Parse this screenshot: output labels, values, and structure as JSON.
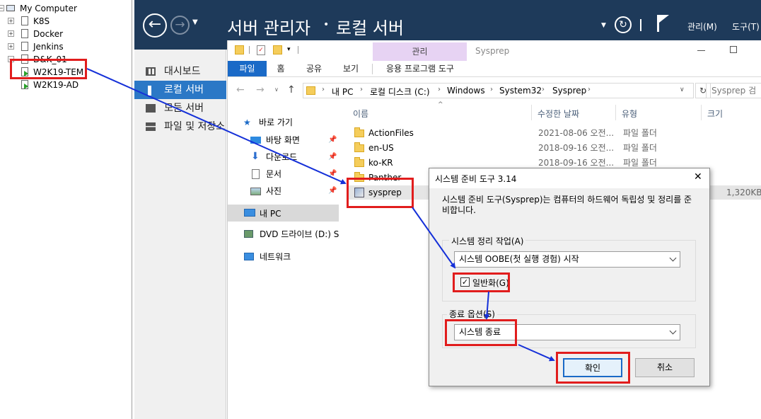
{
  "tree": {
    "root": "My Computer",
    "items": [
      "K8S",
      "Docker",
      "Jenkins",
      "D&K_01",
      "W2K19-TEM",
      "W2K19-AD"
    ]
  },
  "server_manager": {
    "title": "서버 관리자",
    "breadcrumb_sep": "•",
    "page": "로컬 서버",
    "menu_manage": "관리(M)",
    "menu_tools": "도구(T)",
    "nav": [
      "대시보드",
      "로컬 서버",
      "모든 서버",
      "파일 및 저장소"
    ]
  },
  "explorer": {
    "context_tab": "관리",
    "window_title": "Sysprep",
    "tabs": [
      "파일",
      "홈",
      "공유",
      "보기",
      "응용 프로그램 도구"
    ],
    "path": [
      "내 PC",
      "로컬 디스크 (C:)",
      "Windows",
      "System32",
      "Sysprep"
    ],
    "search_placeholder": "Sysprep 검",
    "quick_access": "바로 가기",
    "nav_items": [
      "바탕 화면",
      "다운로드",
      "문서",
      "사진",
      "내 PC",
      "DVD 드라이브 (D:) S",
      "네트워크"
    ],
    "columns": [
      "이름",
      "수정한 날짜",
      "유형",
      "크기"
    ],
    "files": [
      {
        "name": "ActionFiles",
        "date": "2021-08-06 오전...",
        "type": "파일 폴더",
        "size": ""
      },
      {
        "name": "en-US",
        "date": "2018-09-16 오전...",
        "type": "파일 폴더",
        "size": ""
      },
      {
        "name": "ko-KR",
        "date": "2018-09-16 오전...",
        "type": "파일 폴더",
        "size": ""
      },
      {
        "name": "Panther",
        "date": "",
        "type": "",
        "size": ""
      },
      {
        "name": "sysprep",
        "date": "",
        "type": "",
        "size": "1,320KB"
      }
    ]
  },
  "dialog": {
    "title": "시스템 준비 도구 3.14",
    "description": "시스템 준비 도구(Sysprep)는 컴퓨터의 하드웨어 독립성 및 정리를 준비합니다.",
    "cleanup_label": "시스템 정리 작업(A)",
    "cleanup_value": "시스템 OOBE(첫 실행 경험) 시작",
    "generalize_label": "일반화(G)",
    "generalize_checked": true,
    "shutdown_label": "종료 옵션(S)",
    "shutdown_value": "시스템 종료",
    "ok": "확인",
    "cancel": "취소",
    "close": "✕"
  },
  "colors": {
    "highlight": "#e11d1d",
    "arrow": "#1530d8",
    "sm_header": "#1e3a5a",
    "nav_selected": "#2b78c6"
  }
}
